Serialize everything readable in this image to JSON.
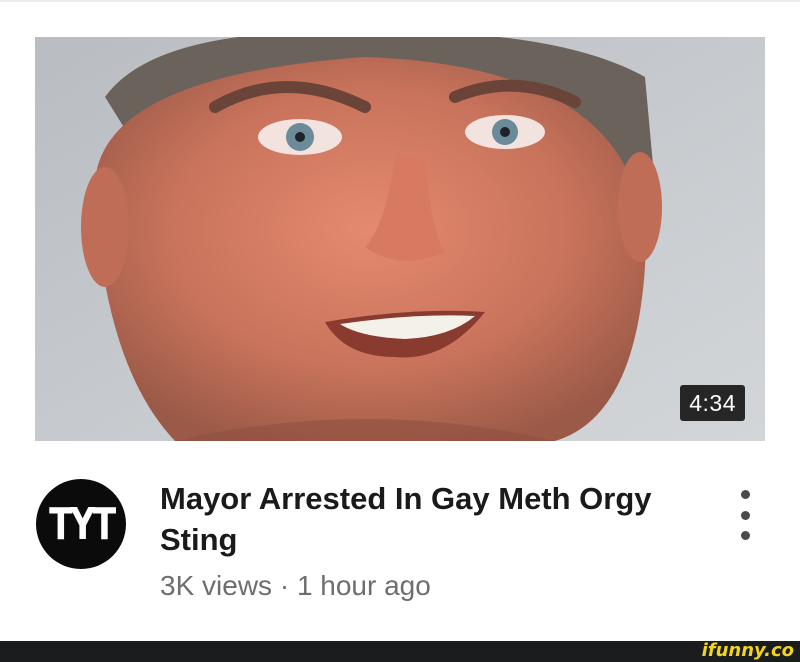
{
  "video": {
    "duration": "4:34",
    "title": "Mayor Arrested In Gay Meth Orgy Sting",
    "views": "3K views",
    "separator": "·",
    "age": "1 hour ago"
  },
  "channel": {
    "avatar_text": "TYT"
  },
  "menu": {
    "icon": "more-vert-icon"
  },
  "watermark": {
    "text": "ifunny.co"
  },
  "colors": {
    "title": "#1a1a1a",
    "meta": "#6e6e6e",
    "avatar_bg": "#0b0b0b",
    "watermark": "#f1d51b",
    "footer": "#1b1c1d"
  }
}
